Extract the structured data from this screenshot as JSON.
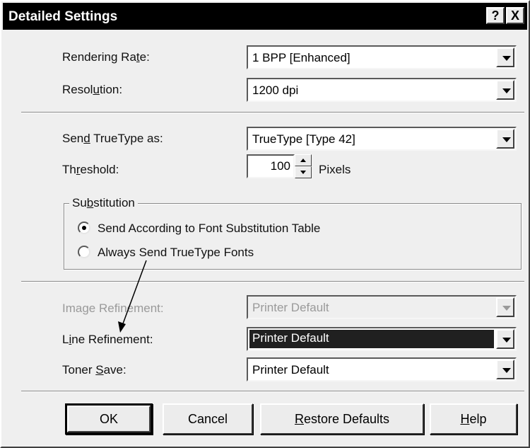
{
  "window": {
    "title": "Detailed Settings",
    "help_button": "?",
    "close_button": "X"
  },
  "fields": {
    "rendering_rate": {
      "label_pre": "Rendering Ra",
      "label_mn": "t",
      "label_post": "e:",
      "value": "1 BPP [Enhanced]"
    },
    "resolution": {
      "label_pre": "Resol",
      "label_mn": "u",
      "label_post": "tion:",
      "value": "1200 dpi"
    },
    "send_truetype": {
      "label_pre": "Sen",
      "label_mn": "d",
      "label_post": " TrueType as:",
      "value": "TrueType [Type 42]"
    },
    "threshold": {
      "label_pre": "Th",
      "label_mn": "r",
      "label_post": "eshold:",
      "value": "100",
      "unit": "Pixels"
    },
    "image_refinement": {
      "label": "Image Refinement:",
      "value": "Printer Default",
      "disabled": true
    },
    "line_refinement": {
      "label_pre": "L",
      "label_mn": "i",
      "label_post": "ne Refinement:",
      "value": "Printer Default"
    },
    "toner_save": {
      "label_pre": "Toner ",
      "label_mn": "S",
      "label_post": "ave:",
      "value": "Printer Default"
    }
  },
  "substitution": {
    "title_pre": "Su",
    "title_mn": "b",
    "title_post": "stitution",
    "options": [
      {
        "label": "Send According to Font Substitution Table",
        "selected": true
      },
      {
        "label": "Always Send TrueType Fonts",
        "selected": false
      }
    ]
  },
  "buttons": {
    "ok": "OK",
    "cancel": "Cancel",
    "restore_pre": "",
    "restore_mn": "R",
    "restore_post": "estore Defaults",
    "help_pre": "",
    "help_mn": "H",
    "help_post": "elp"
  }
}
